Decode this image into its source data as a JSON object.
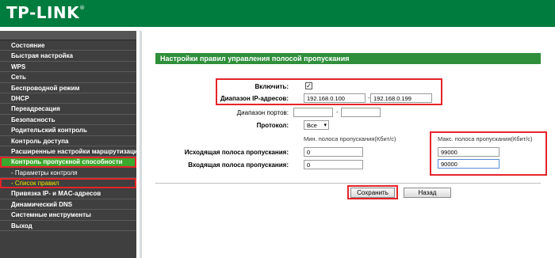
{
  "brand": {
    "name": "TP-LINK",
    "mark": "®"
  },
  "sidebar": {
    "items": [
      {
        "label": "Состояние"
      },
      {
        "label": "Быстрая настройка"
      },
      {
        "label": "WPS"
      },
      {
        "label": "Сеть"
      },
      {
        "label": "Беспроводной режим"
      },
      {
        "label": "DHCP"
      },
      {
        "label": "Переадресация"
      },
      {
        "label": "Безопасность"
      },
      {
        "label": "Родительский контроль"
      },
      {
        "label": "Контроль доступа"
      },
      {
        "label": "Расширенные настройки маршрутизации"
      },
      {
        "label": "Контроль пропускной способности"
      },
      {
        "label": "- Параметры контроля"
      },
      {
        "label": "- Список правил"
      },
      {
        "label": "Привязка IP- и MAC-адресов"
      },
      {
        "label": "Динамический DNS"
      },
      {
        "label": "Системные инструменты"
      },
      {
        "label": "Выход"
      }
    ]
  },
  "main": {
    "title": "Настройки правил управления полосой пропускания",
    "enable_label": "Включить:",
    "enable_checked": "✓",
    "ip_range_label": "Диапазон IP-адресов:",
    "ip_start": "192.168.0.100",
    "ip_end": "192.168.0.199",
    "range_sep": "-",
    "port_range_label": "Диапазон портов:",
    "port_start": "",
    "port_end": "",
    "protocol_label": "Протокол:",
    "protocol_value": "Все",
    "min_header": "Мин. полоса пропускания(Кбит/с)",
    "max_header": "Макс. полоса пропускания(Кбит/с)",
    "egress_label": "Исходящая полоса пропускания:",
    "egress_min": "0",
    "egress_max": "99000",
    "ingress_label": "Входящая полоса пропускания:",
    "ingress_min": "0",
    "ingress_max": "90000",
    "save_label": "Сохранить",
    "back_label": "Назад"
  },
  "colors": {
    "header": "#007c3e",
    "title_bar": "#2f8f3a",
    "active_menu": "#3ca82e",
    "highlight": "#e5242b",
    "sidebar": "#3f3f3f"
  }
}
